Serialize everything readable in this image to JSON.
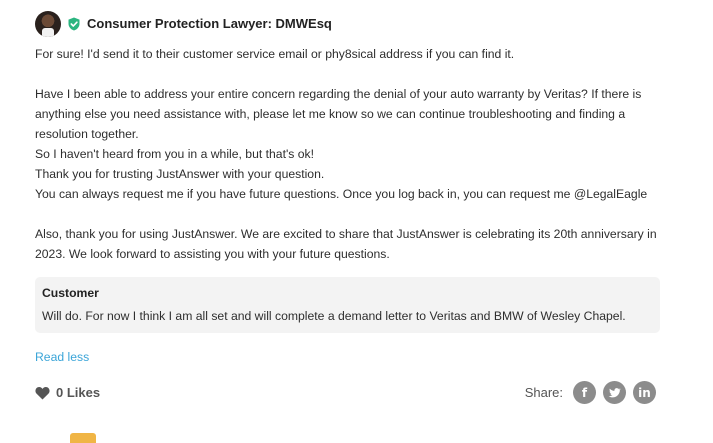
{
  "expert": {
    "name": "Consumer Protection Lawyer: DMWEsq",
    "avatar": "expert-avatar",
    "badge_icon": "verified-check-icon",
    "badge_color": "#2bb580"
  },
  "message": {
    "p1": "For sure! I'd send it to their customer service email or phy8sical address if you can find it.",
    "p2": "Have I been able to address your entire concern regarding the denial of your auto warranty by Veritas? If there is anything else you need assistance with, please let me know so we can continue troubleshooting and finding a resolution together.",
    "p3": "So I haven't heard from you in a while, but that's ok!",
    "p4": "Thank you for trusting JustAnswer with your question.",
    "p5": "You can always request me if you have future questions. Once you log back in, you can request me @LegalEagle",
    "p6": "Also, thank you for using JustAnswer. We are excited to share that JustAnswer is celebrating its 20th anniversary in 2023. We look forward to assisting you with your future questions."
  },
  "customer": {
    "label": "Customer",
    "text": "Will do. For now I think I am all set and will complete a demand letter to Veritas and BMW of Wesley Chapel."
  },
  "actions": {
    "read_less": "Read less",
    "likes": "0 Likes",
    "like_icon": "heart-icon",
    "share_label": "Share:",
    "social": [
      {
        "name": "facebook-icon",
        "glyph": "f"
      },
      {
        "name": "twitter-icon",
        "glyph": ""
      },
      {
        "name": "linkedin-icon",
        "glyph": "in"
      }
    ]
  },
  "colors": {
    "link": "#3ba5d8",
    "social_bg": "#8c8c8c",
    "customer_bg": "#f3f3f3"
  }
}
